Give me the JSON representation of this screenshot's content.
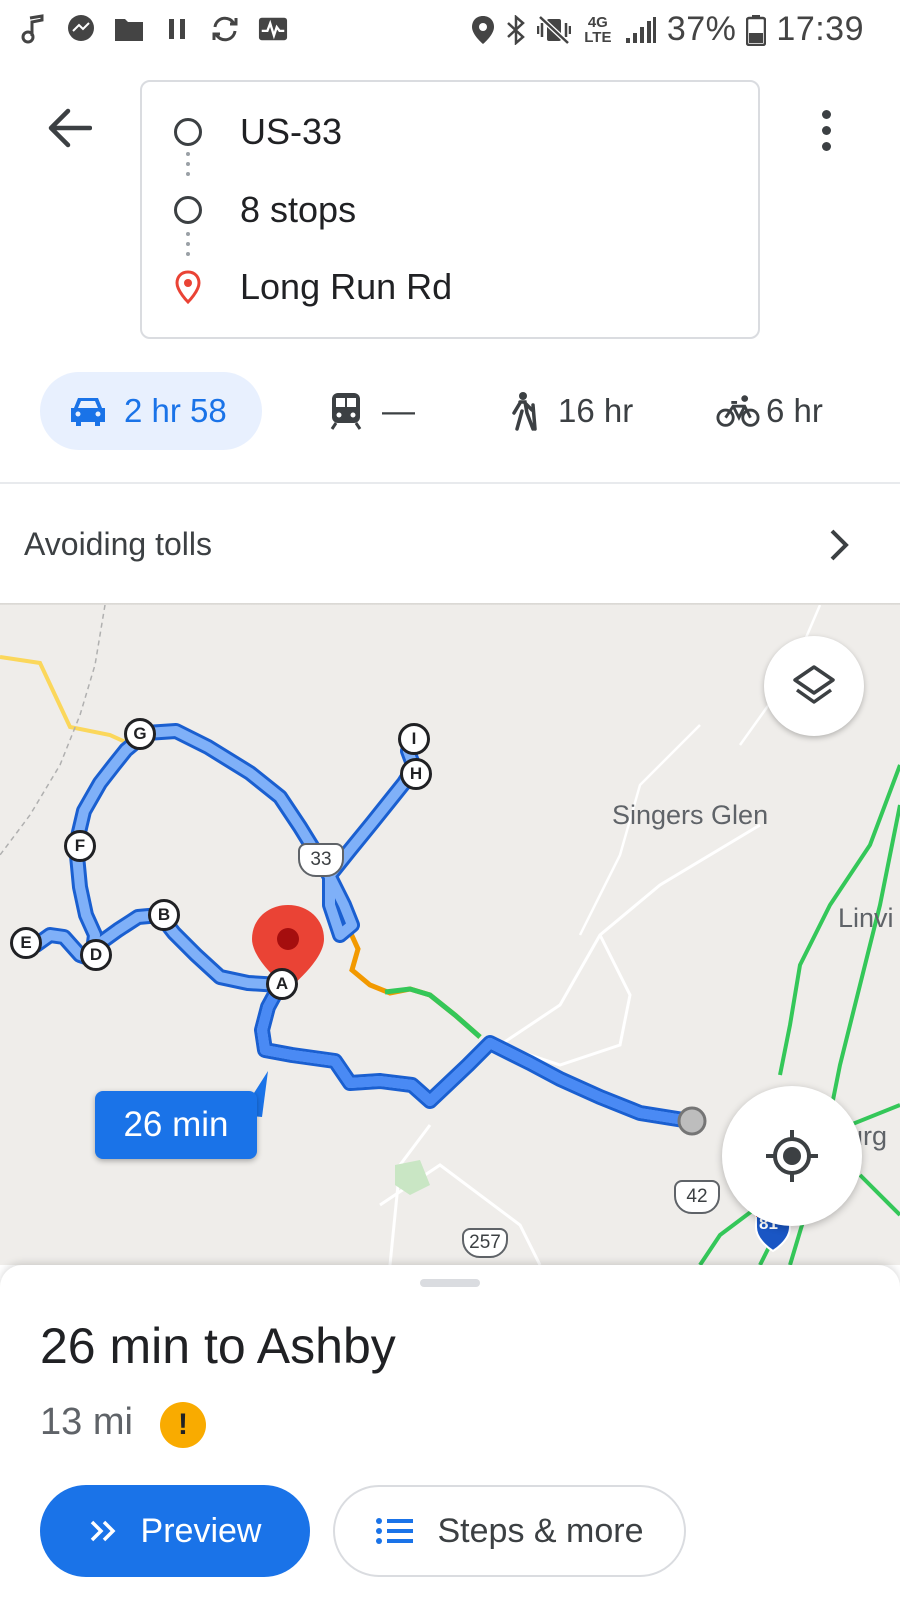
{
  "status_bar": {
    "battery": "37%",
    "time": "17:39",
    "network": "4G LTE",
    "icons": [
      "music-note-icon",
      "messenger-icon",
      "folder-icon",
      "pause-icon",
      "sync-icon",
      "activity-icon",
      "location-icon",
      "bluetooth-icon",
      "vibrate-icon",
      "signal-icon",
      "battery-icon"
    ]
  },
  "route": {
    "origin": "US-33",
    "stops": "8 stops",
    "destination": "Long Run Rd"
  },
  "modes": [
    {
      "name": "drive",
      "label": "2 hr 58",
      "icon": "car-icon",
      "active": true
    },
    {
      "name": "transit",
      "label": "—",
      "icon": "train-icon",
      "active": false
    },
    {
      "name": "walk",
      "label": "16 hr",
      "icon": "walking-icon",
      "active": false
    },
    {
      "name": "bike",
      "label": "6 hr",
      "icon": "bike-icon",
      "active": false
    }
  ],
  "options": {
    "label": "Avoiding tolls"
  },
  "map": {
    "places": [
      "Singers Glen",
      "Linvi",
      "urg"
    ],
    "waypoints": [
      "A",
      "B",
      "D",
      "E",
      "F",
      "G",
      "H",
      "I"
    ],
    "shields": [
      "33",
      "42",
      "257",
      "81"
    ],
    "callout": "26 min",
    "colors": {
      "route": "#4a8af4",
      "route_dark": "#1a5fd0",
      "pin": "#ea4335",
      "traffic_green": "#34c759",
      "traffic_orange": "#f29900",
      "roads_yellow": "#fbd75b"
    }
  },
  "sheet": {
    "title": "26 min to Ashby",
    "distance": "13 mi",
    "warning": "!",
    "preview_label": "Preview",
    "steps_label": "Steps & more"
  }
}
